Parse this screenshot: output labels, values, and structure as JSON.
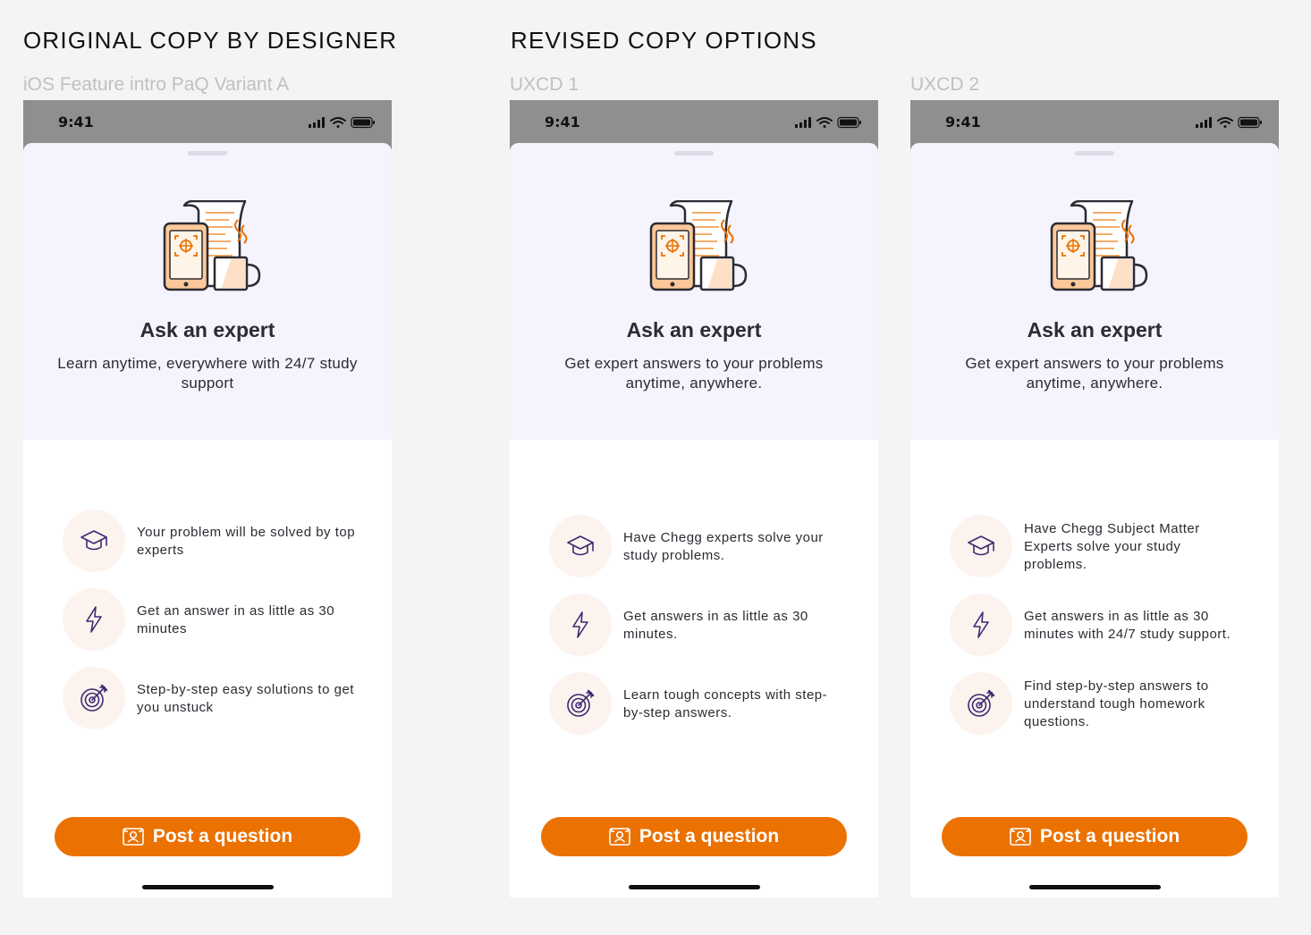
{
  "headings": {
    "original": "ORIGINAL COPY BY DESIGNER",
    "revised": "REVISED COPY OPTIONS"
  },
  "colors": {
    "accent": "#eb7100",
    "hero_bg": "#f5f3fd",
    "icon_circle": "#fdf3ee",
    "icon_stroke": "#3b2a73"
  },
  "variants": [
    {
      "label": "iOS Feature intro PaQ Variant A",
      "status_time": "9:41",
      "title": "Ask an expert",
      "subtitle": "Learn anytime, everywhere with 24/7 study support",
      "features": [
        {
          "icon": "graduation-cap-icon",
          "text": "Your problem will be solved by top experts"
        },
        {
          "icon": "lightning-bolt-icon",
          "text": "Get an answer in as little as 30 minutes"
        },
        {
          "icon": "target-icon",
          "text": "Step-by-step easy solutions to get you unstuck"
        }
      ],
      "cta": "Post a question"
    },
    {
      "label": "UXCD 1",
      "status_time": "9:41",
      "title": "Ask an expert",
      "subtitle": "Get expert answers to your problems anytime, anywhere.",
      "features": [
        {
          "icon": "graduation-cap-icon",
          "text": "Have Chegg experts solve your study problems."
        },
        {
          "icon": "lightning-bolt-icon",
          "text": "Get answers in as little as 30 minutes."
        },
        {
          "icon": "target-icon",
          "text": "Learn tough concepts with step-by-step answers."
        }
      ],
      "cta": "Post a question"
    },
    {
      "label": "UXCD 2",
      "status_time": "9:41",
      "title": "Ask an expert",
      "subtitle": "Get expert answers to your problems anytime, anywhere.",
      "features": [
        {
          "icon": "graduation-cap-icon",
          "text": "Have Chegg Subject Matter Experts solve your study problems."
        },
        {
          "icon": "lightning-bolt-icon",
          "text": "Get answers in as little as 30 minutes with 24/7 study support."
        },
        {
          "icon": "target-icon",
          "text": "Find step-by-step answers to understand tough homework questions."
        }
      ],
      "cta": "Post a question"
    }
  ]
}
